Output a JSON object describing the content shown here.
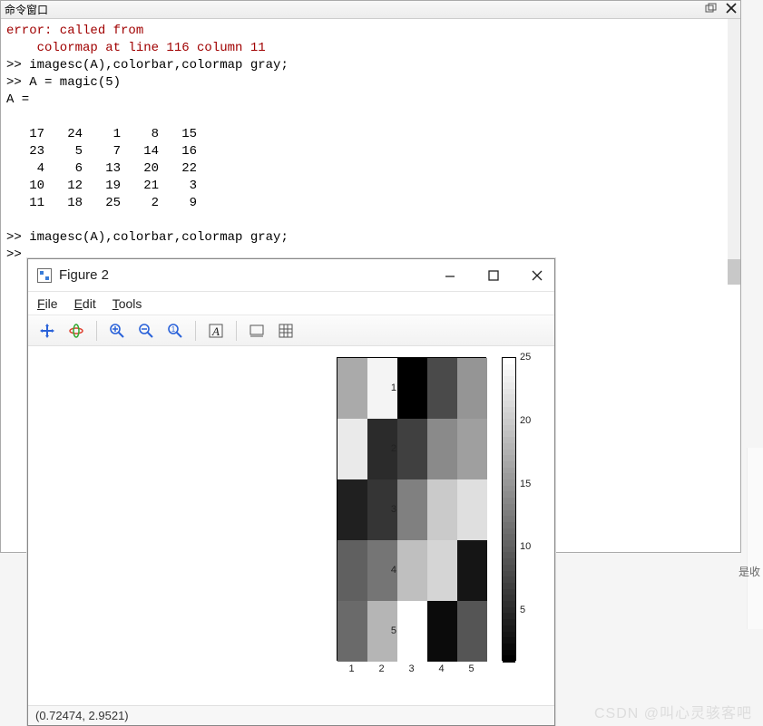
{
  "command_window": {
    "title": "命令窗口",
    "lines": {
      "l1": "error: called from",
      "l2": "    colormap at line 116 column 11",
      "l3": ">> imagesc(A),colorbar,colormap gray;",
      "l4": ">> A = magic(5)",
      "l5": "A =",
      "l6": "",
      "l7": "   17   24    1    8   15",
      "l8": "   23    5    7   14   16",
      "l9": "    4    6   13   20   22",
      "l10": "   10   12   19   21    3",
      "l11": "   11   18   25    2    9",
      "l12": "",
      "l13": ">> imagesc(A),colorbar,colormap gray;",
      "l14": ">> "
    }
  },
  "figure": {
    "title": "Figure 2",
    "menu": {
      "file": "File",
      "edit": "Edit",
      "tools": "Tools"
    },
    "status": "(0.72474, 2.9521)",
    "yticks": [
      "1",
      "2",
      "3",
      "4",
      "5"
    ],
    "xticks": [
      "1",
      "2",
      "3",
      "4",
      "5"
    ],
    "colorbar_ticks": [
      "25",
      "20",
      "15",
      "10",
      "5"
    ]
  },
  "watermark": "CSDN @叫心灵骇客吧",
  "side_label": "是收",
  "chart_data": {
    "type": "heatmap",
    "title": "",
    "xlabel": "",
    "ylabel": "",
    "x_categories": [
      "1",
      "2",
      "3",
      "4",
      "5"
    ],
    "y_categories": [
      "1",
      "2",
      "3",
      "4",
      "5"
    ],
    "values": [
      [
        17,
        24,
        1,
        8,
        15
      ],
      [
        23,
        5,
        7,
        14,
        16
      ],
      [
        4,
        6,
        13,
        20,
        22
      ],
      [
        10,
        12,
        19,
        21,
        3
      ],
      [
        11,
        18,
        25,
        2,
        9
      ]
    ],
    "colormap": "gray",
    "clim": [
      1,
      25
    ],
    "colorbar_ticks": [
      5,
      10,
      15,
      20,
      25
    ]
  }
}
